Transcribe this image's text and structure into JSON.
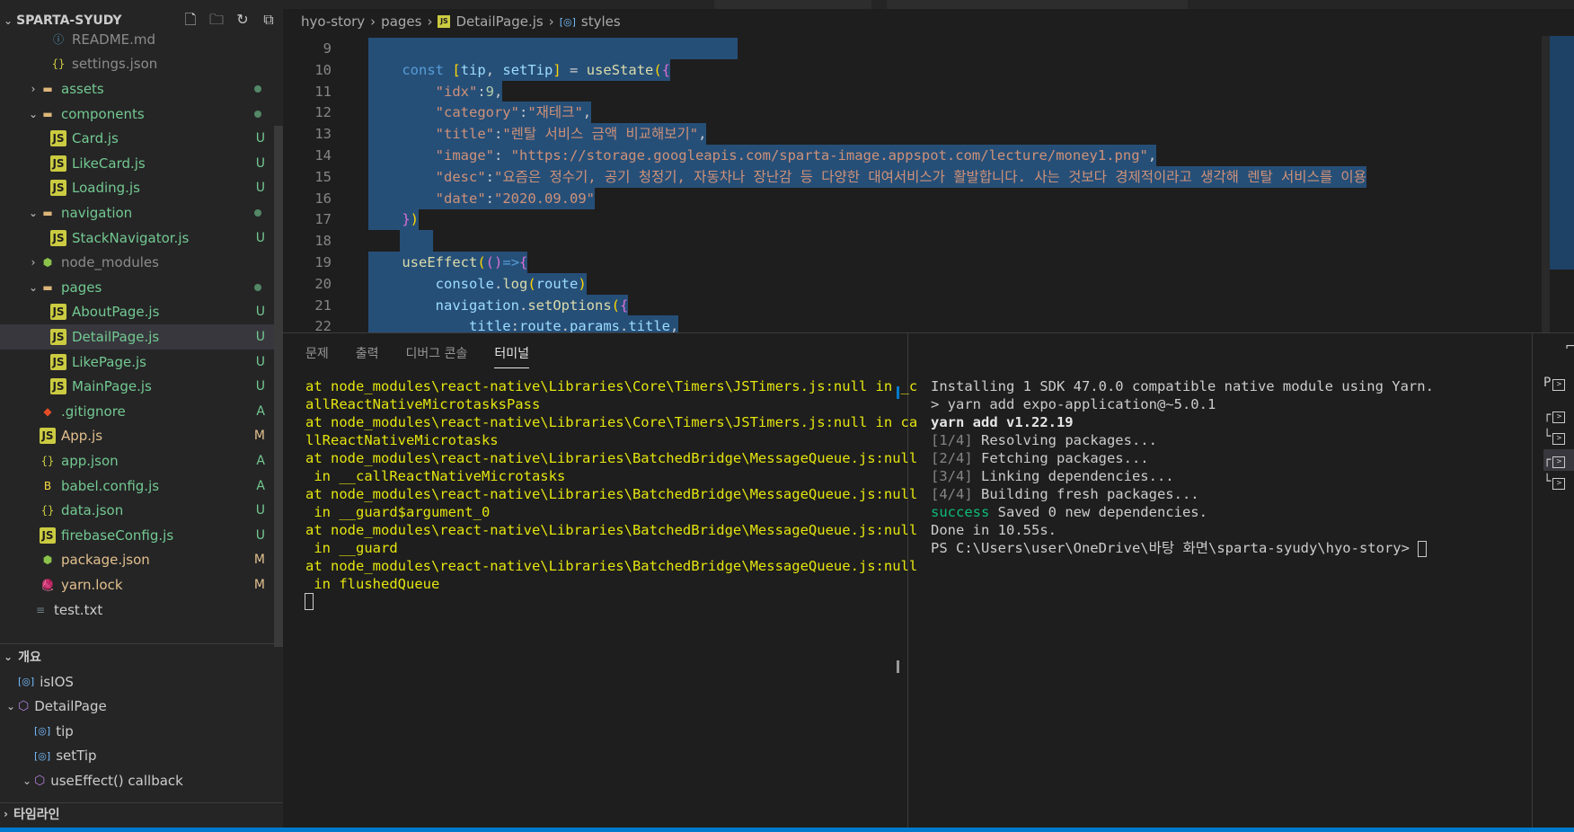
{
  "explorer": {
    "title": "SPARTA-SYUDY",
    "actions": [
      "new-file-icon",
      "new-folder-icon",
      "refresh-icon",
      "collapse-icon"
    ],
    "items": [
      {
        "label": "README.md",
        "indent": 2,
        "icon": "info",
        "color": "gray",
        "badge": ""
      },
      {
        "label": "settings.json",
        "indent": 2,
        "icon": "json",
        "color": "gray",
        "badge": ""
      },
      {
        "label": "assets",
        "indent": 1,
        "icon": "folder",
        "chev": "›",
        "color": "green",
        "badge": "dot"
      },
      {
        "label": "components",
        "indent": 1,
        "icon": "folder",
        "chev": "⌄",
        "color": "green",
        "badge": "dot"
      },
      {
        "label": "Card.js",
        "indent": 2,
        "icon": "js",
        "color": "green",
        "badge": "U"
      },
      {
        "label": "LikeCard.js",
        "indent": 2,
        "icon": "js",
        "color": "green",
        "badge": "U"
      },
      {
        "label": "Loading.js",
        "indent": 2,
        "icon": "js",
        "color": "green",
        "badge": "U"
      },
      {
        "label": "navigation",
        "indent": 1,
        "icon": "folder",
        "chev": "⌄",
        "color": "green",
        "badge": "dot"
      },
      {
        "label": "StackNavigator.js",
        "indent": 2,
        "icon": "js",
        "color": "green",
        "badge": "U"
      },
      {
        "label": "node_modules",
        "indent": 1,
        "icon": "node",
        "chev": "›",
        "color": "gray",
        "badge": ""
      },
      {
        "label": "pages",
        "indent": 1,
        "icon": "folder",
        "chev": "⌄",
        "color": "green",
        "badge": "dot"
      },
      {
        "label": "AboutPage.js",
        "indent": 2,
        "icon": "js",
        "color": "green",
        "badge": "U"
      },
      {
        "label": "DetailPage.js",
        "indent": 2,
        "icon": "js",
        "color": "green",
        "badge": "U",
        "selected": true
      },
      {
        "label": "LikePage.js",
        "indent": 2,
        "icon": "js",
        "color": "green",
        "badge": "U"
      },
      {
        "label": "MainPage.js",
        "indent": 2,
        "icon": "js",
        "color": "green",
        "badge": "U"
      },
      {
        "label": ".gitignore",
        "indent": 1,
        "icon": "git",
        "color": "green",
        "badge": "A"
      },
      {
        "label": "App.js",
        "indent": 1,
        "icon": "js",
        "color": "yellow",
        "badge": "M"
      },
      {
        "label": "app.json",
        "indent": 1,
        "icon": "json",
        "color": "green",
        "badge": "A"
      },
      {
        "label": "babel.config.js",
        "indent": 1,
        "icon": "babel",
        "color": "green",
        "badge": "A"
      },
      {
        "label": "data.json",
        "indent": 1,
        "icon": "json",
        "color": "green",
        "badge": "U"
      },
      {
        "label": "firebaseConfig.js",
        "indent": 1,
        "icon": "js",
        "color": "green",
        "badge": "U"
      },
      {
        "label": "package.json",
        "indent": 1,
        "icon": "node",
        "color": "yellow",
        "badge": "M"
      },
      {
        "label": "yarn.lock",
        "indent": 1,
        "icon": "yarn",
        "color": "yellow",
        "badge": "M"
      },
      {
        "label": "test.txt",
        "indent": 0,
        "icon": "txt",
        "color": "default",
        "badge": ""
      }
    ]
  },
  "outline": {
    "title": "개요",
    "items": [
      {
        "label": "isIOS",
        "kind": "var",
        "indent": 0
      },
      {
        "label": "DetailPage",
        "kind": "fn",
        "indent": 0,
        "chev": "⌄"
      },
      {
        "label": "tip",
        "kind": "var",
        "indent": 1
      },
      {
        "label": "setTip",
        "kind": "var",
        "indent": 1
      },
      {
        "label": "useEffect() callback",
        "kind": "fn",
        "indent": 1,
        "chev": "⌄"
      }
    ]
  },
  "timeline": {
    "title": "타임라인"
  },
  "breadcrumb": {
    "root": "hyo-story",
    "folder": "pages",
    "file": "DetailPage.js",
    "symbol": "styles"
  },
  "editor": {
    "lines": [
      {
        "num": "9",
        "html": ""
      },
      {
        "num": "10",
        "html": "<span class='k'>const</span> <span class='br2'>[</span><span class='v'>tip</span>, <span class='v'>setTip</span><span class='br2'>]</span> = <span class='f'>useState</span><span class='br2'>(</span><span class='br'>{</span>"
      },
      {
        "num": "11",
        "html": "    <span class='s'>\"idx\"</span>:<span class='n'>9</span>,"
      },
      {
        "num": "12",
        "html": "    <span class='s'>\"category\"</span>:<span class='s'>\"재테크\"</span>,"
      },
      {
        "num": "13",
        "html": "    <span class='s'>\"title\"</span>:<span class='s'>\"렌탈 서비스 금액 비교해보기\"</span>,"
      },
      {
        "num": "14",
        "html": "    <span class='s'>\"image\"</span>: <span class='s'>\"https://storage.googleapis.com/sparta-image.appspot.com/lecture/money1.png\"</span>,"
      },
      {
        "num": "15",
        "html": "    <span class='s'>\"desc\"</span>:<span class='s'>\"요즘은 정수기, 공기 청정기, 자동차나 장난감 등 다양한 대여서비스가 활발합니다. 사는 것보다 경제적이라고 생각해 렌탈 서비스를 이용</span>"
      },
      {
        "num": "16",
        "html": "    <span class='s'>\"date\"</span>:<span class='s'>\"2020.09.09\"</span>"
      },
      {
        "num": "17",
        "html": "<span class='br'>}</span><span class='br2'>)</span>"
      },
      {
        "num": "18",
        "html": ""
      },
      {
        "num": "19",
        "html": "<span class='f'>useEffect</span><span class='br2'>(</span><span class='br'>(</span><span class='br'>)</span><span class='k'>=&gt;</span><span class='br'>{</span>"
      },
      {
        "num": "20",
        "html": "    <span class='v'>console</span>.<span class='f'>log</span><span class='br2'>(</span><span class='v'>route</span><span class='br2'>)</span>"
      },
      {
        "num": "21",
        "html": "    <span class='v'>navigation</span>.<span class='f'>setOptions</span><span class='br2'>(</span><span class='br'>{</span>"
      },
      {
        "num": "22",
        "html": "        <span class='v'>title</span>:<span class='v'>route</span>.<span class='v'>params</span>.<span class='v'>title</span>,"
      }
    ]
  },
  "panel": {
    "tabs": [
      "문제",
      "출력",
      "디버그 콘솔",
      "터미널"
    ],
    "active_tab": "터미널"
  },
  "terminal_left": [
    "at node_modules\\react-native\\Libraries\\Core\\Timers\\JSTimers.js:null in _c",
    "allReactNativeMicrotasksPass",
    "at node_modules\\react-native\\Libraries\\Core\\Timers\\JSTimers.js:null in ca",
    "llReactNativeMicrotasks",
    "at node_modules\\react-native\\Libraries\\BatchedBridge\\MessageQueue.js:null",
    " in __callReactNativeMicrotasks",
    "at node_modules\\react-native\\Libraries\\BatchedBridge\\MessageQueue.js:null",
    " in __guard$argument_0",
    "at node_modules\\react-native\\Libraries\\BatchedBridge\\MessageQueue.js:null",
    " in __guard",
    "at node_modules\\react-native\\Libraries\\BatchedBridge\\MessageQueue.js:null",
    " in flushedQueue"
  ],
  "terminal_right": [
    {
      "pre": "",
      "main": "Installing 1 SDK 47.0.0 compatible native module using Yarn.",
      "style": "tw"
    },
    {
      "pre": "",
      "main": "> yarn add expo-application@~5.0.1",
      "style": "tw"
    },
    {
      "pre": "",
      "main": "yarn add v1.22.19",
      "style": "tb"
    },
    {
      "pre": "[1/4]",
      "main": " Resolving packages...",
      "style": "tw"
    },
    {
      "pre": "[2/4]",
      "main": " Fetching packages...",
      "style": "tw"
    },
    {
      "pre": "[3/4]",
      "main": " Linking dependencies...",
      "style": "tw"
    },
    {
      "pre": "[4/4]",
      "main": " Building fresh packages...",
      "style": "tw"
    },
    {
      "pre": "success",
      "main": " Saved 0 new dependencies.",
      "style": "tw",
      "pre_style": "tg"
    },
    {
      "pre": "",
      "main": "Done in 10.55s.",
      "style": "tw"
    },
    {
      "pre": "",
      "main": "PS C:\\Users\\user\\OneDrive\\바탕 화면\\sparta-syudy\\hyo-story> ",
      "style": "tw"
    }
  ],
  "terminal_list": [
    "P",
    "┌",
    "└",
    "┌",
    "└"
  ],
  "colors": {
    "accent": "#007acc",
    "selection": "#264f78",
    "untracked": "#73c991",
    "modified": "#e2c08d"
  }
}
